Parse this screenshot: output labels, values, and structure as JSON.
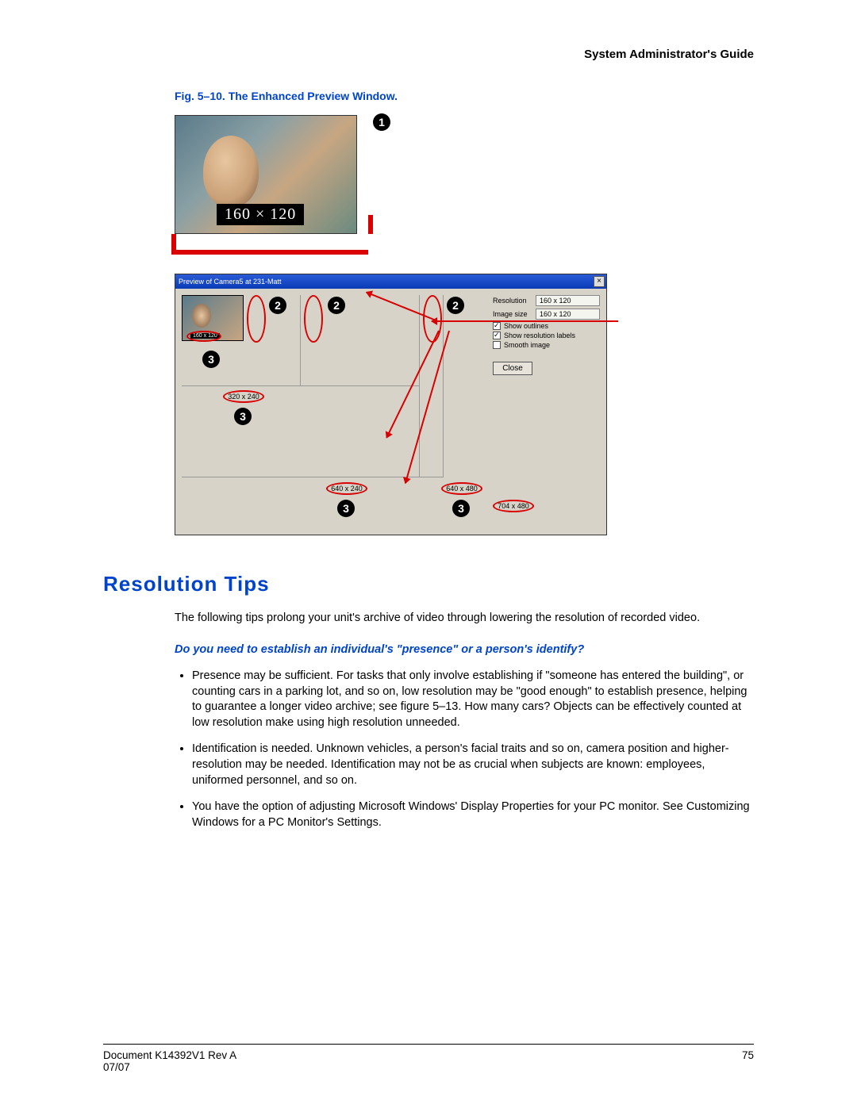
{
  "header": {
    "title": "System Administrator's Guide"
  },
  "figure": {
    "caption": "Fig. 5–10.    The Enhanced Preview Window.",
    "large_resolution_label": "160 × 120",
    "callouts": {
      "one": "1",
      "two": "2",
      "three": "3"
    },
    "window": {
      "title": "Preview of Camera5 at 231-Matt",
      "close_x": "×",
      "thumb_label": "160 x 120",
      "panel": {
        "resolution_label": "Resolution",
        "resolution_value": "160 x 120",
        "image_size_label": "Image size",
        "image_size_value": "160 x 120",
        "show_outlines": "Show outlines",
        "show_resolution_labels": "Show resolution labels",
        "smooth_image": "Smooth image",
        "close": "Close"
      },
      "res_labels": {
        "r320": "320 x 240",
        "r640_240": "640 x 240",
        "r640_480": "640 x 480",
        "r704_480": "704 x 480"
      }
    }
  },
  "section": {
    "heading": "Resolution Tips",
    "intro": "The following tips prolong your unit's archive of video through lowering the resolution of recorded video.",
    "subheading": "Do you need to establish an individual's \"presence\" or a person's identify?",
    "bullets": [
      "Presence may be sufficient. For tasks that  only involve establishing if \"someone has entered the building\", or counting cars in a parking lot, and so on, low resolution may be \"good enough\" to establish presence, helping to guarantee a longer video archive; see figure 5–13. How many cars? Objects can be effectively counted at low resolution make using high resolution unneeded.",
      "Identification is needed. Unknown vehicles, a person's facial traits and so on, camera position and higher-resolution may be needed. Identification may not be as crucial when subjects are known: employees, uniformed personnel, and so on.",
      "You have the option of adjusting Microsoft Windows' Display Properties for your PC monitor. See Customizing Windows for a PC Monitor's Settings."
    ]
  },
  "footer": {
    "doc": "Document K14392V1 Rev A",
    "date": "07/07",
    "page": "75"
  }
}
